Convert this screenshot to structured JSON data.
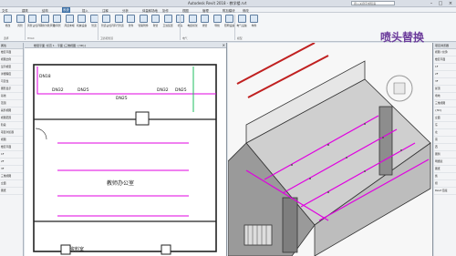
{
  "app": {
    "title": "Autodesk Revit 2018 - 教学楼.rvt",
    "search_placeholder": "键入关键字或短语"
  },
  "menu": [
    "文件",
    "建筑",
    "结构",
    "系统",
    "插入",
    "注释",
    "分析",
    "体量和场地",
    "协作",
    "视图",
    "管理",
    "附加模块",
    "修改"
  ],
  "menu_active_index": 3,
  "ribbon": {
    "buttons": [
      "修改",
      "风管",
      "风管占位符",
      "转换为软风管",
      "软风管",
      "风道末端",
      "机械设备",
      "管道",
      "管道占位符",
      "平行管道",
      "管件",
      "管路附件",
      "软管",
      "卫浴装置",
      "喷头",
      "电缆桥架",
      "线管",
      "导线",
      "照明设备",
      "电气设备",
      "构件"
    ],
    "groups": [
      "选择",
      "HVAC",
      "卫浴和管道",
      "电气",
      "模型"
    ]
  },
  "caption": "喷头替换",
  "left_panel": {
    "title": "属性",
    "rows": [
      "楼层平面",
      "视图比例",
      "显示模型",
      "详细程度",
      "可见性",
      "图形显示",
      "基线",
      "范围",
      "裁剪视图",
      "视图范围",
      "阶段",
      "项目浏览器",
      "视图",
      "楼层平面",
      "1F",
      "2F",
      "3F",
      "三维视图",
      "立面",
      "图纸"
    ]
  },
  "plan_view": {
    "tab_label": "楼层平面: 标高 1 - 平面 [三维视图: {3D}]",
    "labels": {
      "pipe_a": "DN32",
      "pipe_b": "DN25",
      "pipe_c": "DN25",
      "pipe_d": "DN32",
      "pipe_e": "DN25",
      "pipe_f": "DN18",
      "room": "教师办公室",
      "room2": "资料室"
    }
  },
  "right_panel": {
    "title": "项目浏览器",
    "rows": [
      "视图 (全部)",
      "楼层平面",
      "1F",
      "2F",
      "3F",
      "屋顶",
      "场地",
      "三维视图",
      "{3D}",
      "立面",
      "东",
      "北",
      "南",
      "西",
      "图例",
      "明细表",
      "图纸",
      "族",
      "组",
      "Revit 链接"
    ]
  },
  "colors": {
    "accent": "#3a6ea5",
    "pipe": "#e000e0",
    "caption": "#6a3a9a"
  }
}
